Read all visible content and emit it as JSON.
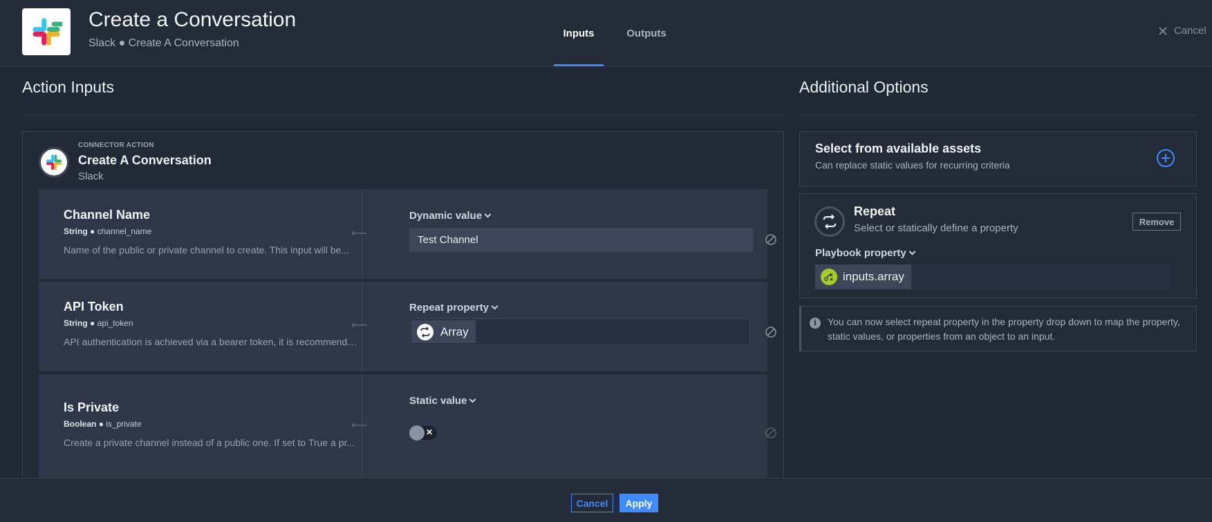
{
  "header": {
    "title": "Create a Conversation",
    "subtitle": "Slack ● Create A Conversation",
    "tabs": [
      {
        "label": "Inputs",
        "active": true
      },
      {
        "label": "Outputs",
        "active": false
      }
    ],
    "cancel_label": "Cancel",
    "accent_color": "#3d8bff"
  },
  "action_inputs": {
    "title": "Action Inputs",
    "connector": {
      "kicker": "CONNECTOR ACTION",
      "name": "Create A Conversation",
      "vendor": "Slack",
      "icon": "slack-logo"
    },
    "rows": [
      {
        "title": "Channel Name",
        "type": "String",
        "key": "channel_name",
        "description": "Name of the public or private channel to create. This input will be...",
        "mode": "Dynamic value",
        "value": "Test Channel"
      },
      {
        "title": "API Token",
        "type": "String",
        "key": "api_token",
        "description": "API authentication is achieved via a bearer token, it is recommended...",
        "mode": "Repeat property",
        "value": "Array",
        "value_icon": "repeat-icon"
      },
      {
        "title": "Is Private",
        "type": "Boolean",
        "key": "is_private",
        "description": "Create a private channel instead of a public one. If set to True a pr...",
        "mode": "Static value",
        "toggle_on": false
      }
    ]
  },
  "additional_options": {
    "title": "Additional Options",
    "assets": {
      "title": "Select from available assets",
      "subtitle": "Can replace static values for recurring criteria"
    },
    "repeat": {
      "title": "Repeat",
      "subtitle": "Select or statically define a property",
      "remove_label": "Remove",
      "property_label": "Playbook property",
      "property_value": "inputs.array"
    },
    "info": "You can now select repeat property in the property drop down to map the property, static values, or properties from an object to an input."
  },
  "footer": {
    "cancel_label": "Cancel",
    "apply_label": "Apply"
  }
}
